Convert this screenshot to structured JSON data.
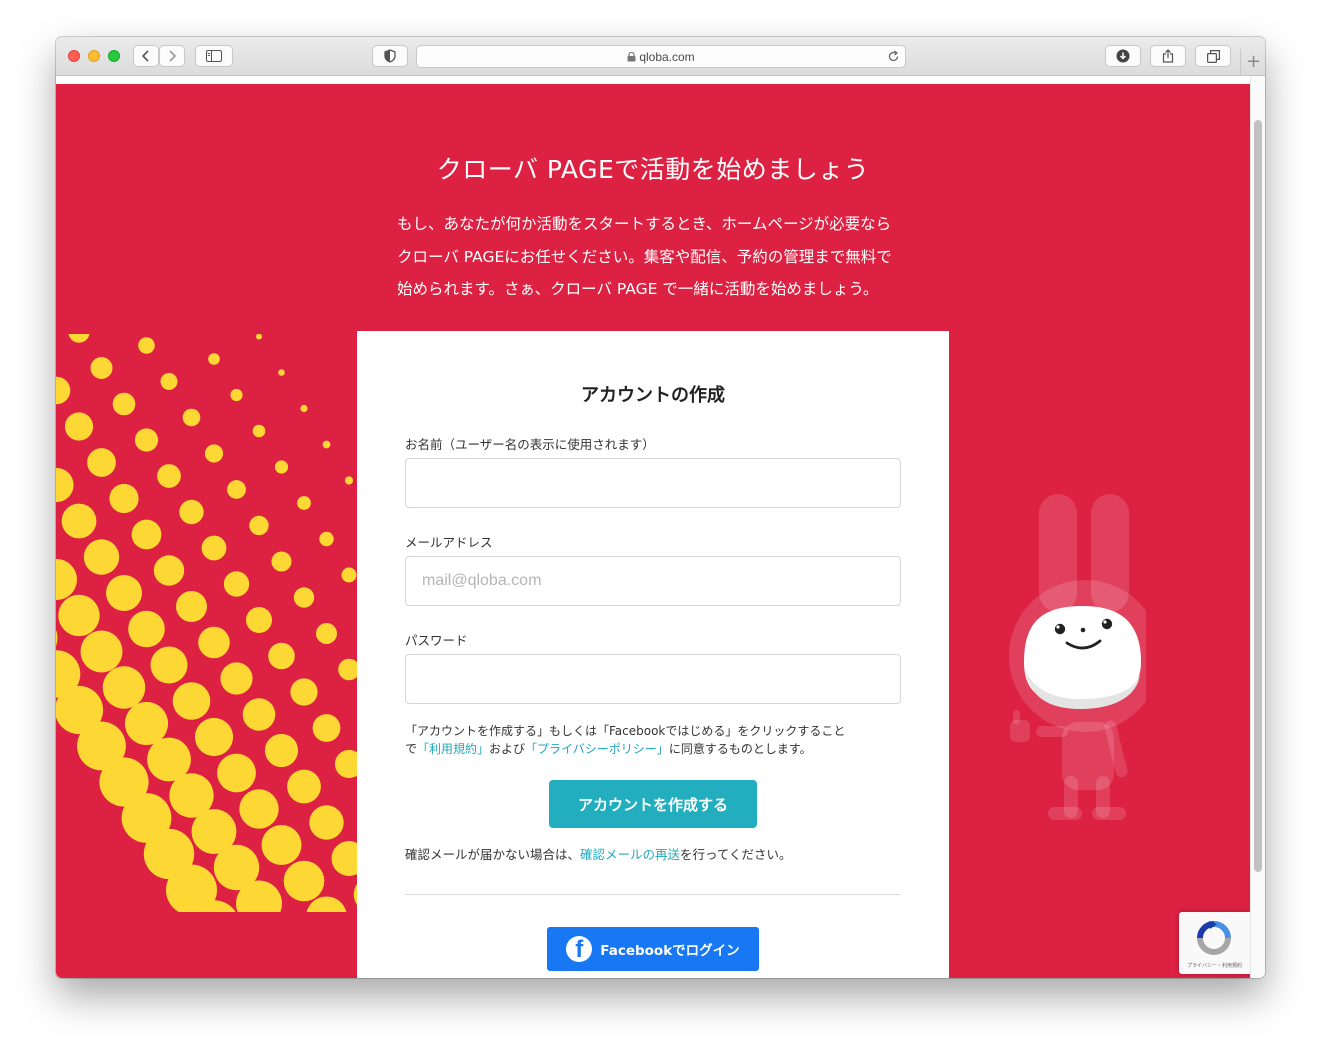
{
  "browser": {
    "url": "qloba.com",
    "icons": {
      "back": "chevron-left-icon",
      "forward": "chevron-right-icon",
      "sidebar": "sidebar-icon",
      "privacy": "shield-icon",
      "lock": "lock-icon",
      "reload": "reload-icon",
      "downloads": "download-icon",
      "share": "share-icon",
      "tabs": "tabs-icon",
      "new_tab": "plus-icon"
    }
  },
  "hero": {
    "title": "クローバ PAGEで活動を始めましょう",
    "description_lines": [
      "もし、あなたが何か活動をスタートするとき、ホームページが必要なら",
      "クローバ PAGEにお任せください。集客や配信、予約の管理まで無料で",
      "始められます。さぁ、クローバ PAGE で一緒に活動を始めましょう。"
    ]
  },
  "form": {
    "title": "アカウントの作成",
    "name_label": "お名前（ユーザー名の表示に使用されます）",
    "name_value": "",
    "email_label": "メールアドレス",
    "email_placeholder": "mail@qloba.com",
    "password_label": "パスワード",
    "password_value": "",
    "terms_line1": "「アカウントを作成する」もしくは「Facebookではじめる」をクリックすること",
    "terms_prefix": "で",
    "terms_link_tos": "「利用規約」",
    "terms_and": "および",
    "terms_link_privacy": "「プライバシーポリシー」",
    "terms_suffix": "に同意するものとします。",
    "create_button": "アカウントを作成する",
    "resend_prefix": "確認メールが届かない場合は、",
    "resend_link": "確認メールの再送",
    "resend_suffix": "を行ってください。",
    "facebook_button": "Facebookでログイン",
    "facebook_glyph": "f"
  },
  "recaptcha": {
    "footer": "プライバシー・利用規約"
  },
  "colors": {
    "hero_bg": "#dc2142",
    "dots": "#fdd835",
    "accent_button": "#22aebf",
    "link": "#23a8bd",
    "facebook": "#1877f2"
  }
}
